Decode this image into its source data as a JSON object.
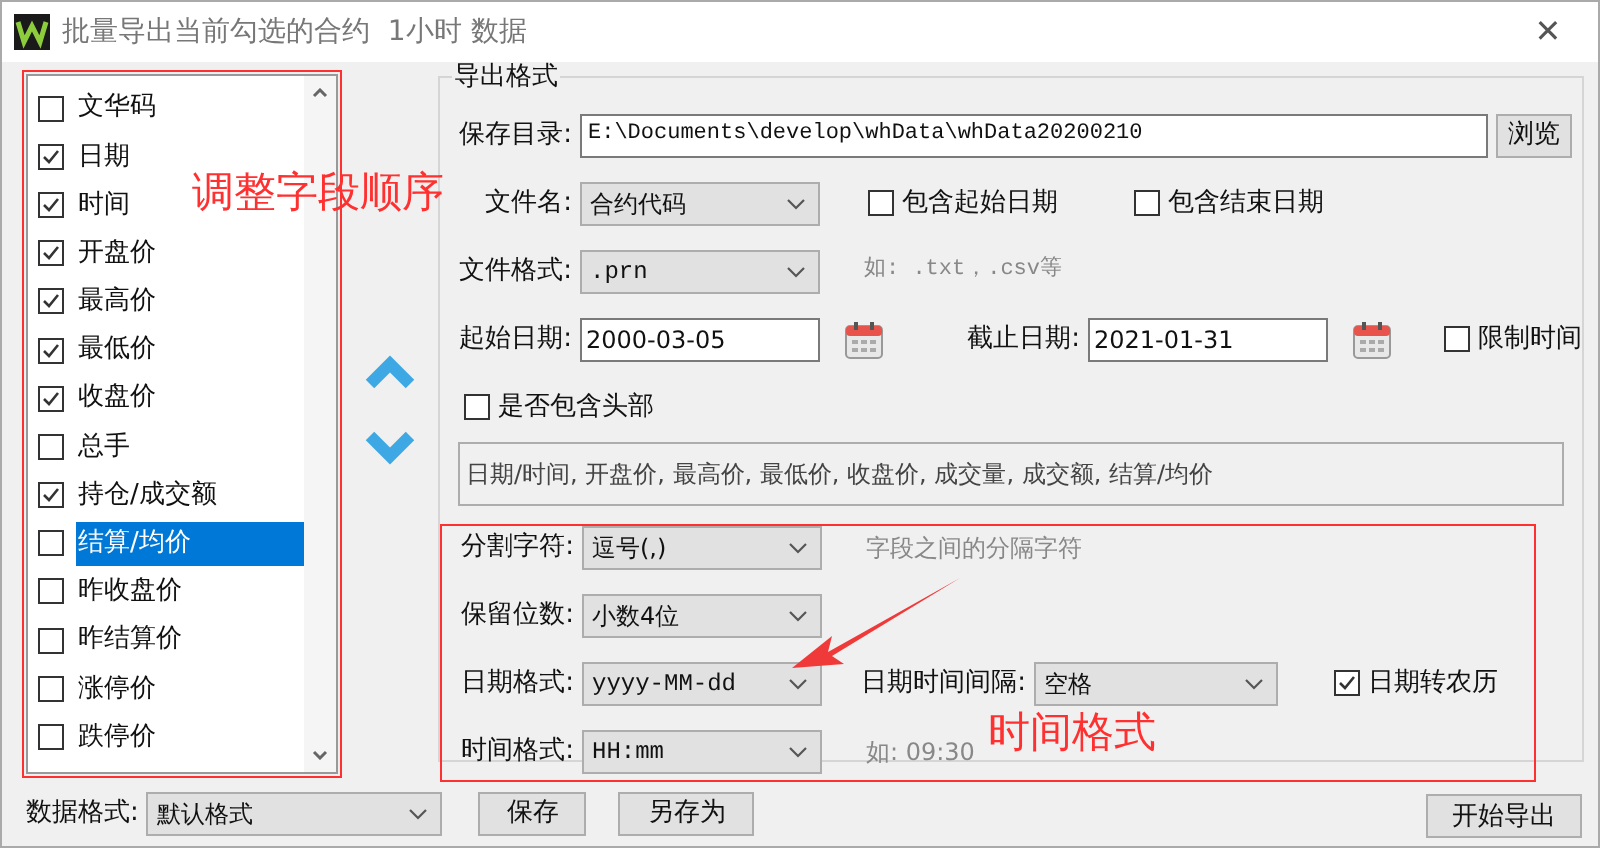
{
  "window": {
    "title": "批量导出当前勾选的合约  1小时 数据",
    "close": "✕"
  },
  "fields": [
    {
      "label": "文华码",
      "checked": false,
      "selected": false
    },
    {
      "label": "日期",
      "checked": true,
      "selected": false
    },
    {
      "label": "时间",
      "checked": true,
      "selected": false
    },
    {
      "label": "开盘价",
      "checked": true,
      "selected": false
    },
    {
      "label": "最高价",
      "checked": true,
      "selected": false
    },
    {
      "label": "最低价",
      "checked": true,
      "selected": false
    },
    {
      "label": "收盘价",
      "checked": true,
      "selected": false
    },
    {
      "label": "总手",
      "checked": false,
      "selected": false
    },
    {
      "label": "持仓/成交额",
      "checked": true,
      "selected": false
    },
    {
      "label": "结算/均价",
      "checked": false,
      "selected": true
    },
    {
      "label": "昨收盘价",
      "checked": false,
      "selected": false
    },
    {
      "label": "昨结算价",
      "checked": false,
      "selected": false
    },
    {
      "label": "涨停价",
      "checked": false,
      "selected": false
    },
    {
      "label": "跌停价",
      "checked": false,
      "selected": false
    }
  ],
  "export_format": {
    "title": "导出格式",
    "save_dir": {
      "label": "保存目录:",
      "value": "E:\\Documents\\develop\\whData\\whData20200210",
      "browse": "浏览"
    },
    "file_name": {
      "label": "文件名:",
      "value": "合约代码"
    },
    "include_start": {
      "label": "包含起始日期",
      "checked": false
    },
    "include_end": {
      "label": "包含结束日期",
      "checked": false
    },
    "file_format": {
      "label": "文件格式:",
      "value": ".prn",
      "hint": "如: .txt，.csv等"
    },
    "start_date": {
      "label": "起始日期:",
      "value": "2000-03-05"
    },
    "end_date": {
      "label": "截止日期:",
      "value": "2021-01-31"
    },
    "limit_time": {
      "label": "限制时间",
      "checked": false
    },
    "include_header": {
      "label": "是否包含头部",
      "checked": false
    },
    "field_preview": "日期/时间, 开盘价, 最高价, 最低价, 收盘价, 成交量, 成交额, 结算/均价",
    "separator": {
      "label": "分割字符:",
      "value": "逗号(,)",
      "hint": "字段之间的分隔字符"
    },
    "decimals": {
      "label": "保留位数:",
      "value": "小数4位"
    },
    "date_format": {
      "label": "日期格式:",
      "value": "yyyy-MM-dd"
    },
    "datetime_gap": {
      "label": "日期时间间隔:",
      "value": "空格"
    },
    "lunar": {
      "label": "日期转农历",
      "checked": true
    },
    "time_format": {
      "label": "时间格式:",
      "value": "HH:mm",
      "hint": "如: 09:30"
    }
  },
  "bottom": {
    "data_format": {
      "label": "数据格式:",
      "value": "默认格式"
    },
    "save": "保存",
    "save_as": "另存为",
    "start_export": "开始导出"
  },
  "annotations": [
    "调整字段顺序",
    "时间格式"
  ]
}
